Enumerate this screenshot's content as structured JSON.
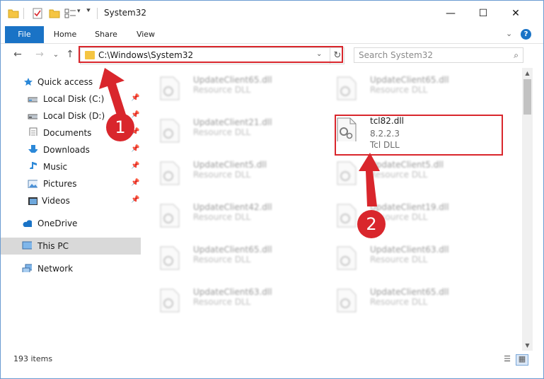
{
  "window": {
    "title": "System32",
    "controls": {
      "minimize": "—",
      "maximize": "☐",
      "close": "✕"
    }
  },
  "ribbon": {
    "tabs": [
      {
        "label": "File"
      },
      {
        "label": "Home"
      },
      {
        "label": "Share"
      },
      {
        "label": "View"
      }
    ],
    "help_label": "?"
  },
  "address": {
    "path": "C:\\Windows\\System32",
    "search_placeholder": "Search System32"
  },
  "nav": {
    "items": [
      {
        "label": "Quick access",
        "icon": "star-icon",
        "pinned": false
      },
      {
        "label": "Local Disk (C:)",
        "icon": "drive-icon",
        "pinned": true
      },
      {
        "label": "Local Disk (D:)",
        "icon": "drive-icon",
        "pinned": true
      },
      {
        "label": "Documents",
        "icon": "documents-icon",
        "pinned": true
      },
      {
        "label": "Downloads",
        "icon": "downloads-icon",
        "pinned": true
      },
      {
        "label": "Music",
        "icon": "music-icon",
        "pinned": true
      },
      {
        "label": "Pictures",
        "icon": "pictures-icon",
        "pinned": true
      },
      {
        "label": "Videos",
        "icon": "videos-icon",
        "pinned": true
      },
      {
        "label": "OneDrive",
        "icon": "onedrive-icon",
        "pinned": false
      },
      {
        "label": "This PC",
        "icon": "this-pc-icon",
        "pinned": false
      },
      {
        "label": "Network",
        "icon": "network-icon",
        "pinned": false
      }
    ]
  },
  "files": {
    "left_column": [
      {
        "name": "UpdateClient65.dll",
        "type": "Resource DLL"
      },
      {
        "name": "UpdateClient21.dll",
        "type": "Resource DLL"
      },
      {
        "name": "UpdateClient5.dll",
        "type": "Resource DLL"
      },
      {
        "name": "UpdateClient42.dll",
        "type": "Resource DLL"
      },
      {
        "name": "UpdateClient65.dll",
        "type": "Resource DLL"
      },
      {
        "name": "UpdateClient63.dll",
        "type": "Resource DLL"
      }
    ],
    "right_column": [
      {
        "name": "UpdateClient65.dll",
        "type": "Resource DLL"
      },
      {
        "name": "tcl82.dll",
        "version": "8.2.2.3",
        "type": "Tcl DLL"
      },
      {
        "name": "UpdateClient5.dll",
        "type": "Resource DLL"
      },
      {
        "name": "UpdateClient19.dll",
        "type": "Resource DLL"
      },
      {
        "name": "UpdateClient63.dll",
        "type": "Resource DLL"
      },
      {
        "name": "UpdateClient65.dll",
        "type": "Resource DLL"
      }
    ]
  },
  "status": {
    "item_count": "193 items"
  },
  "annotations": {
    "step1": "1",
    "step2": "2",
    "color": "#d9262c"
  }
}
